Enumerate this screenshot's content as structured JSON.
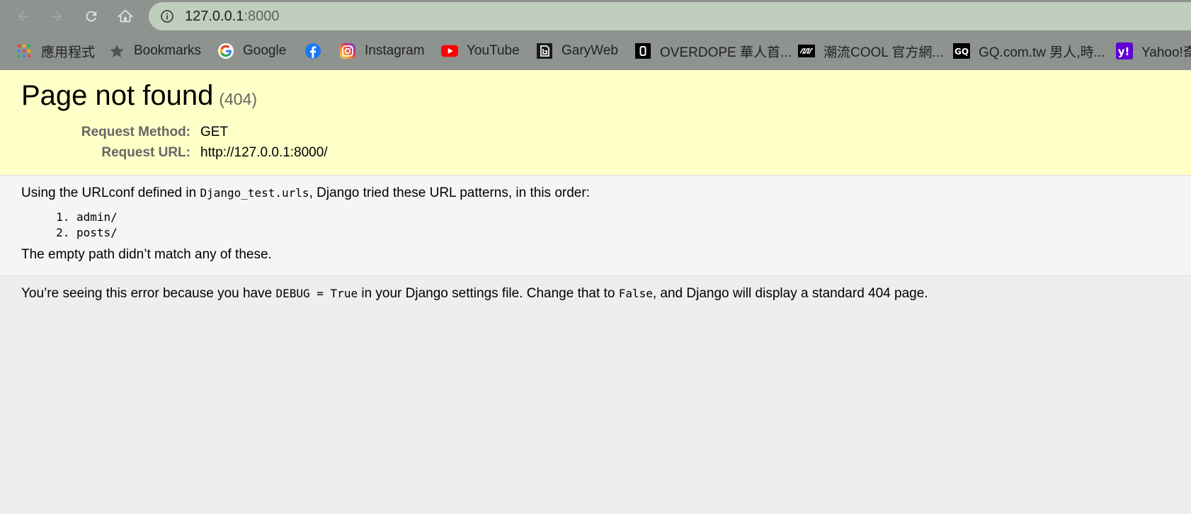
{
  "browser": {
    "address": {
      "host": "127.0.0.1",
      "port": ":8000"
    },
    "nav": {
      "back": "back-arrow-icon",
      "forward": "forward-arrow-icon",
      "reload": "reload-icon",
      "home": "home-icon"
    },
    "bookmarks": [
      {
        "label": "應用程式",
        "icon": "apps-grid-icon"
      },
      {
        "label": "Bookmarks",
        "icon": "star-icon"
      },
      {
        "label": "Google",
        "icon": "google-icon"
      },
      {
        "label": "",
        "icon": "facebook-icon"
      },
      {
        "label": "Instagram",
        "icon": "instagram-icon"
      },
      {
        "label": "YouTube",
        "icon": "youtube-icon"
      },
      {
        "label": "GaryWeb",
        "icon": "garyweb-icon"
      },
      {
        "label": "OVERDOPE 華人首...",
        "icon": "overdope-icon"
      },
      {
        "label": "潮流COOL 官方網...",
        "icon": "cool-icon"
      },
      {
        "label": "GQ.com.tw 男人,時...",
        "icon": "gq-icon"
      },
      {
        "label": "Yahoo!奇",
        "icon": "yahoo-icon"
      }
    ]
  },
  "error": {
    "title": "Page not found",
    "code": "(404)",
    "request_method_label": "Request Method:",
    "request_method": "GET",
    "request_url_label": "Request URL:",
    "request_url": "http://127.0.0.1:8000/"
  },
  "info": {
    "intro_prefix": "Using the URLconf defined in ",
    "urlconf": "Django_test.urls",
    "intro_suffix": ", Django tried these URL patterns, in this order:",
    "patterns": [
      "admin/",
      "posts/"
    ],
    "no_match": "The empty path didn’t match any of these."
  },
  "explanation": {
    "part1": "You’re seeing this error because you have ",
    "debug_setting": "DEBUG = True",
    "part2": " in your Django settings file. Change that to ",
    "false_value": "False",
    "part3": ", and Django will display a standard 404 page."
  },
  "colors": {
    "summary_bg": "#ffffc8",
    "info_bg": "#f5f5f5",
    "page_bg": "#eeeeee",
    "omnibox_bg": "#bfcebd",
    "chrome_bg": "#8e938f"
  }
}
